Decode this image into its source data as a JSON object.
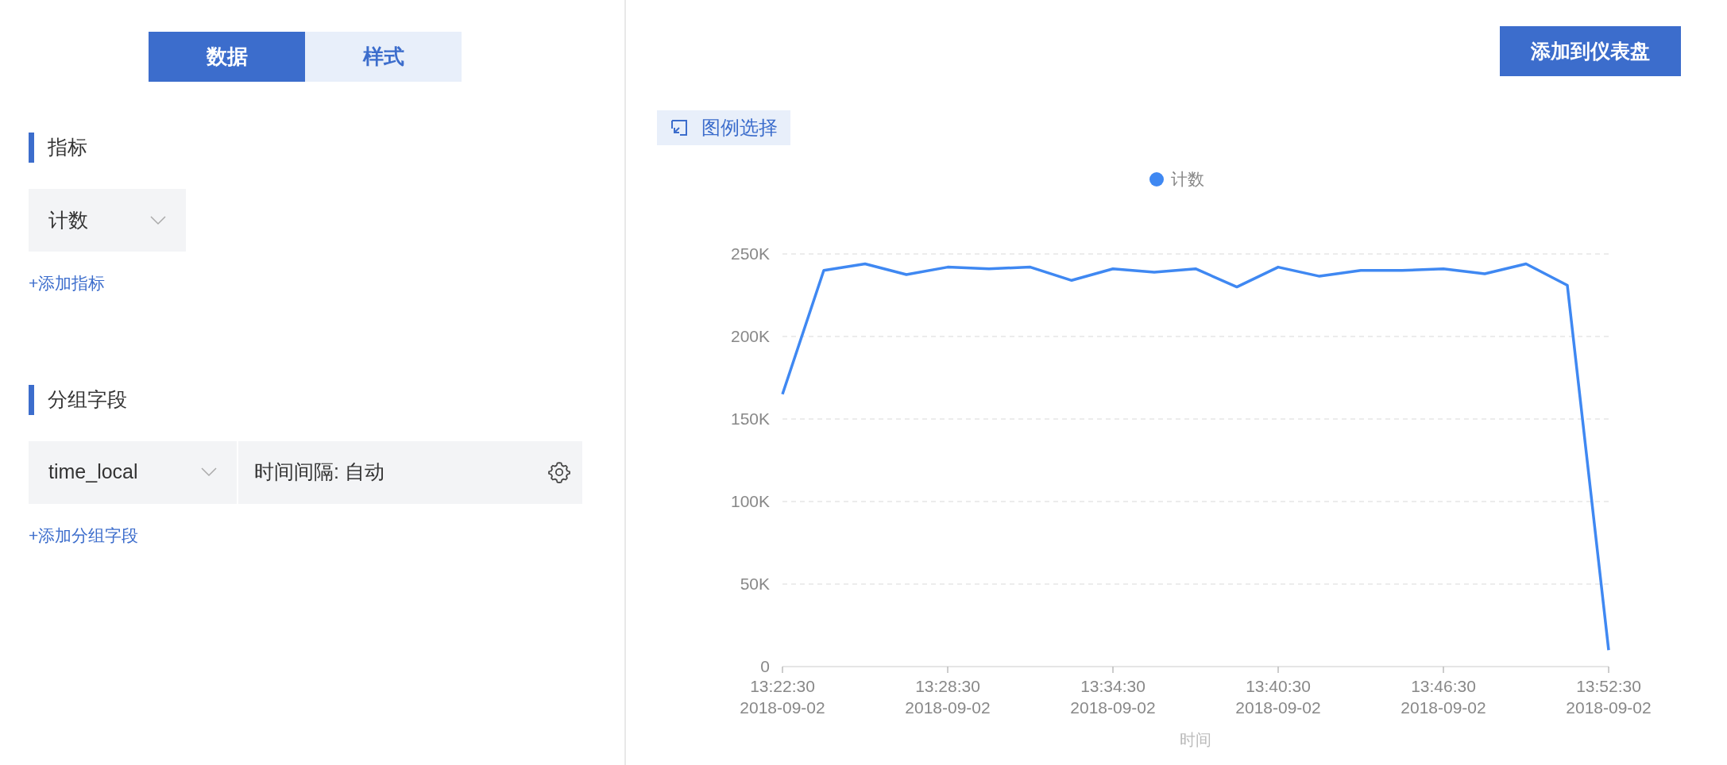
{
  "tabs": [
    {
      "label": "数据",
      "selected": true
    },
    {
      "label": "样式",
      "selected": false
    }
  ],
  "metrics_section": {
    "title": "指标",
    "dropdown": {
      "value": "计数"
    },
    "add_link": "+添加指标"
  },
  "group_section": {
    "title": "分组字段",
    "field_dropdown": {
      "value": "time_local"
    },
    "interval": "时间间隔: 自动",
    "add_link": "+添加分组字段"
  },
  "add_to_dashboard_button": "添加到仪表盘",
  "legend_select_button": "图例选择",
  "chart": {
    "chart_data": {
      "type": "line",
      "xlabel": "时间",
      "categories": [
        "13:22:30\n2018-09-02",
        null,
        null,
        null,
        "13:28:30\n2018-09-02",
        null,
        null,
        null,
        "13:34:30\n2018-09-02",
        null,
        null,
        null,
        "13:40:30\n2018-09-02",
        null,
        null,
        null,
        "13:46:30\n2018-09-02",
        null,
        null,
        null,
        "13:52:30\n2018-09-02"
      ],
      "grid": true,
      "series": [
        {
          "name": "计数",
          "color": "#3f88f2",
          "values": [
            165000,
            240000,
            244000,
            237500,
            242000,
            241000,
            242000,
            234000,
            241000,
            239000,
            241000,
            230000,
            242000,
            236500,
            240000,
            240000,
            241000,
            238000,
            244000,
            231000,
            10000
          ]
        }
      ],
      "ylim": [
        0,
        250000
      ],
      "yticks": [
        {
          "value": 0,
          "label": "0"
        },
        {
          "value": 50000,
          "label": "50K"
        },
        {
          "value": 100000,
          "label": "100K"
        },
        {
          "value": 150000,
          "label": "150K"
        },
        {
          "value": 200000,
          "label": "200K"
        },
        {
          "value": 250000,
          "label": "250K"
        }
      ]
    }
  }
}
